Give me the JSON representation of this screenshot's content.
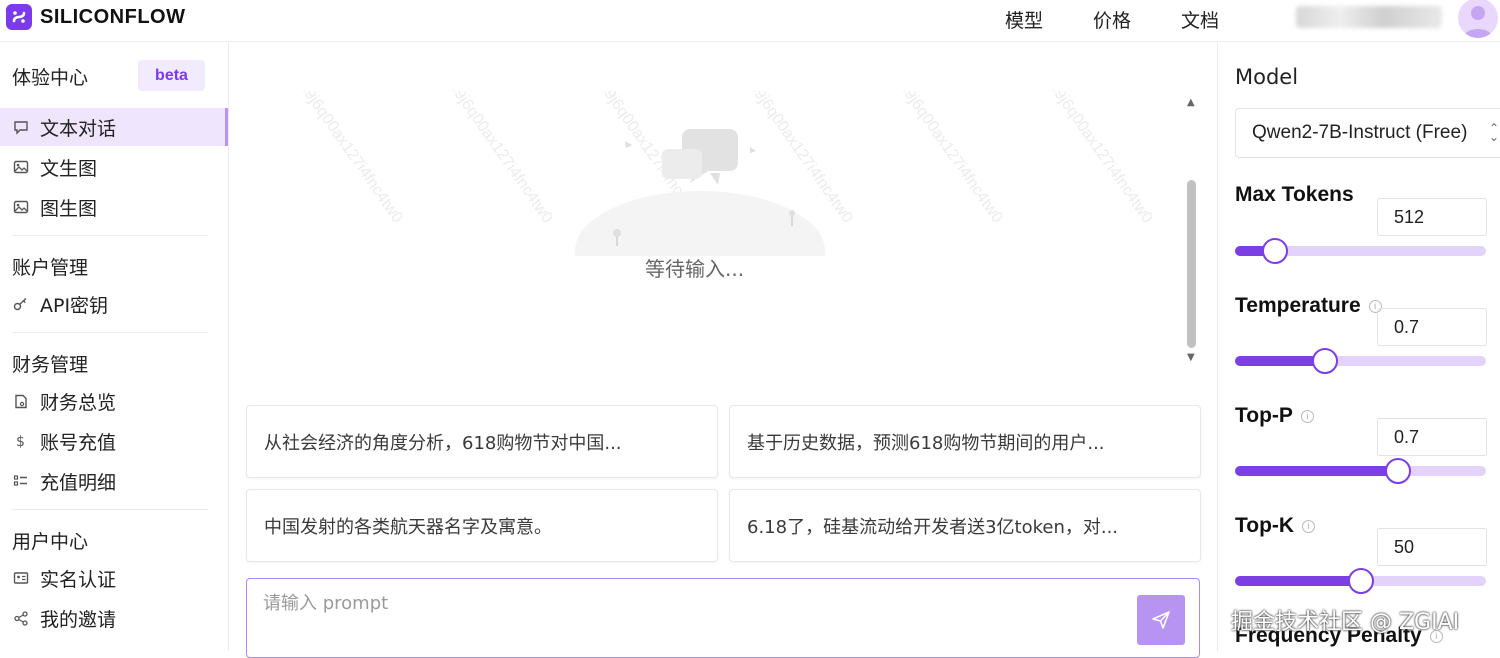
{
  "header": {
    "brand": "SILICONFLOW",
    "nav": [
      "模型",
      "价格",
      "文档"
    ],
    "user_suffix": "·IZU"
  },
  "sidebar": {
    "experience_title": "体验中心",
    "beta": "beta",
    "experience_items": [
      {
        "label": "文本对话",
        "icon": "chat-icon",
        "active": true
      },
      {
        "label": "文生图",
        "icon": "image-icon"
      },
      {
        "label": "图生图",
        "icon": "image-icon"
      }
    ],
    "account_title": "账户管理",
    "account_items": [
      {
        "label": "API密钥",
        "icon": "key-icon"
      }
    ],
    "finance_title": "财务管理",
    "finance_items": [
      {
        "label": "财务总览",
        "icon": "file-icon"
      },
      {
        "label": "账号充值",
        "icon": "dollar-icon"
      },
      {
        "label": "充值明细",
        "icon": "list-icon"
      }
    ],
    "user_title": "用户中心",
    "user_items": [
      {
        "label": "实名认证",
        "icon": "id-card-icon"
      },
      {
        "label": "我的邀请",
        "icon": "share-icon"
      }
    ]
  },
  "main": {
    "waiting_text": "等待输入...",
    "watermark": "c1z569j6q00ax127i4fnc4tw0",
    "suggestions": [
      "从社会经济的角度分析，618购物节对中国...",
      "基于历史数据，预测618购物节期间的用户...",
      "中国发射的各类航天器名字及寓意。",
      "6.18了，硅基流动给开发者送3亿token，对..."
    ],
    "prompt_placeholder": "请输入 prompt"
  },
  "panel": {
    "model_title": "Model",
    "model_value": "Qwen2-7B-Instruct (Free)",
    "params": [
      {
        "label": "Max Tokens",
        "value": "512",
        "fraction": 0.16,
        "info": false
      },
      {
        "label": "Temperature",
        "value": "0.7",
        "fraction": 0.36,
        "info": true
      },
      {
        "label": "Top-P",
        "value": "0.7",
        "fraction": 0.65,
        "info": true
      },
      {
        "label": "Top-K",
        "value": "50",
        "fraction": 0.5,
        "info": true
      },
      {
        "label": "Frequency Penalty",
        "value": "",
        "fraction": null,
        "info": true
      }
    ]
  },
  "watermark_overlay": "掘金技术社区 @ ZGIAI",
  "colors": {
    "accent": "#7b3fe4",
    "accent_light": "#e3d3fb",
    "active_bg": "#efe6fd"
  }
}
